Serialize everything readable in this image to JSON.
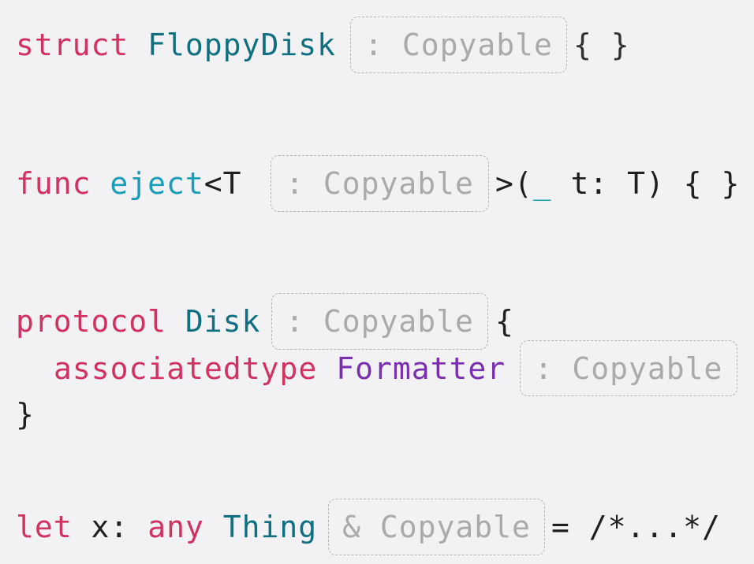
{
  "lines": {
    "struct": {
      "keyword": "struct",
      "name": "FloppyDisk",
      "constraint": ": Copyable",
      "tail": "{ }"
    },
    "func": {
      "keyword": "func",
      "name": "eject",
      "generic_open": "<T",
      "constraint": ": Copyable",
      "params_open": ">(",
      "underscore": "_",
      "params_rest": " t: T) { }"
    },
    "protocol": {
      "keyword": "protocol",
      "name": "Disk",
      "constraint": ": Copyable",
      "brace_open": "{",
      "assoc_keyword": "associatedtype",
      "assoc_name": "Formatter",
      "assoc_constraint": ": Copyable",
      "brace_close": "}"
    },
    "let": {
      "keyword": "let",
      "var": "x:",
      "any": "any",
      "type": "Thing",
      "constraint": "& Copyable",
      "tail": "= /*...*/"
    }
  },
  "colors": {
    "background": "#f2f2f5",
    "keyword": "#d23262",
    "type": "#11707f",
    "function": "#1a9db8",
    "associated_type": "#7a2fb0",
    "plain": "#1f1f1f",
    "constraint_text": "#aaaaaa",
    "constraint_border": "#b4b4b8"
  }
}
